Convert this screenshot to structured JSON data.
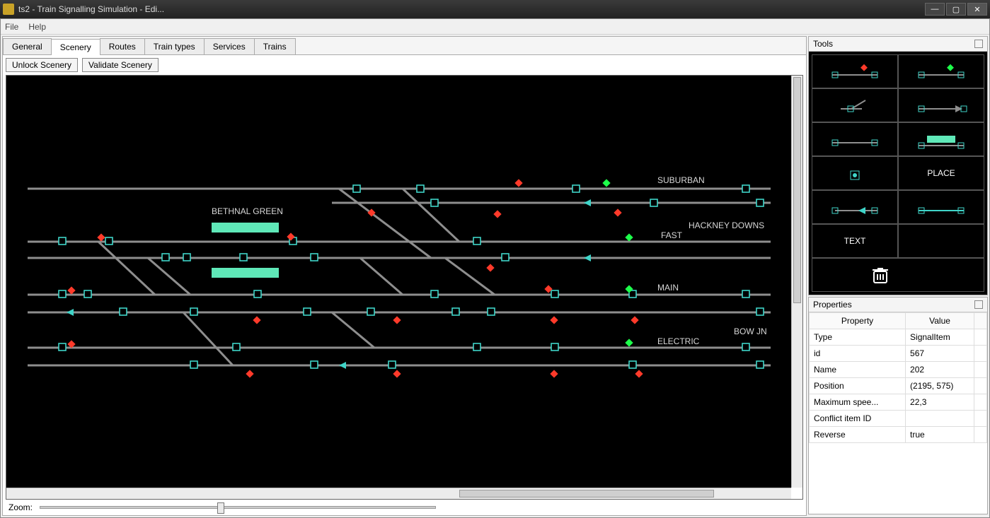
{
  "window": {
    "title": "ts2 - Train Signalling Simulation - Edi..."
  },
  "menu": {
    "file": "File",
    "help": "Help"
  },
  "tabs": [
    "General",
    "Scenery",
    "Routes",
    "Train types",
    "Services",
    "Trains"
  ],
  "active_tab": "Scenery",
  "toolbar": {
    "unlock": "Unlock Scenery",
    "validate": "Validate Scenery"
  },
  "zoom": {
    "label": "Zoom:"
  },
  "labels": {
    "suburban": "SUBURBAN",
    "bethnal": "BETHNAL GREEN",
    "hackney": "HACKNEY DOWNS",
    "fast": "FAST",
    "main": "MAIN",
    "bowjn": "BOW JN",
    "electric": "ELECTRIC"
  },
  "tools": {
    "title": "Tools",
    "place": "PLACE",
    "text": "TEXT"
  },
  "properties": {
    "title": "Properties",
    "col_property": "Property",
    "col_value": "Value",
    "rows": [
      {
        "k": "Type",
        "v": "SignalItem"
      },
      {
        "k": "id",
        "v": "567"
      },
      {
        "k": "Name",
        "v": "202"
      },
      {
        "k": "Position",
        "v": "(2195, 575)"
      },
      {
        "k": "Maximum spee...",
        "v": "22,3"
      },
      {
        "k": "Conflict item ID",
        "v": ""
      },
      {
        "k": "Reverse",
        "v": "true"
      }
    ]
  }
}
